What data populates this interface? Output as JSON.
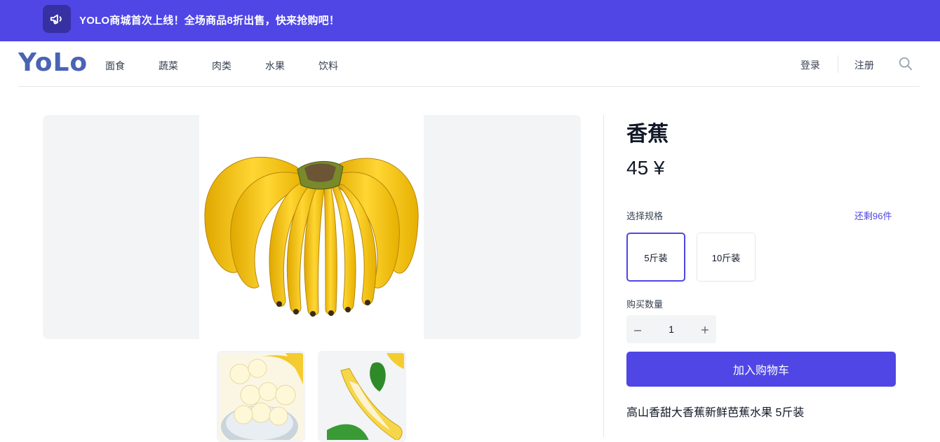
{
  "banner": {
    "icon": "megaphone-icon",
    "text": "YOLO商城首次上线！全场商品8折出售，快来抢购吧！"
  },
  "nav": {
    "logo": "YoLo",
    "items": [
      "面食",
      "蔬菜",
      "肉类",
      "水果",
      "饮料"
    ],
    "login": "登录",
    "register": "注册",
    "search_icon": "search-icon"
  },
  "product": {
    "title": "香蕉",
    "price": "45 ¥",
    "spec_label": "选择规格",
    "stock": "还剩96件",
    "specs": [
      "5斤装",
      "10斤装"
    ],
    "selected_spec": "5斤装",
    "quantity_label": "购买数量",
    "quantity": "1",
    "add_to_cart": "加入购物车",
    "description": "高山香甜大香蕉新鲜芭蕉水果 5斤装"
  },
  "colors": {
    "brand": "#4f46e5",
    "logo": "#4a63b5",
    "banana": "#f5c518"
  }
}
